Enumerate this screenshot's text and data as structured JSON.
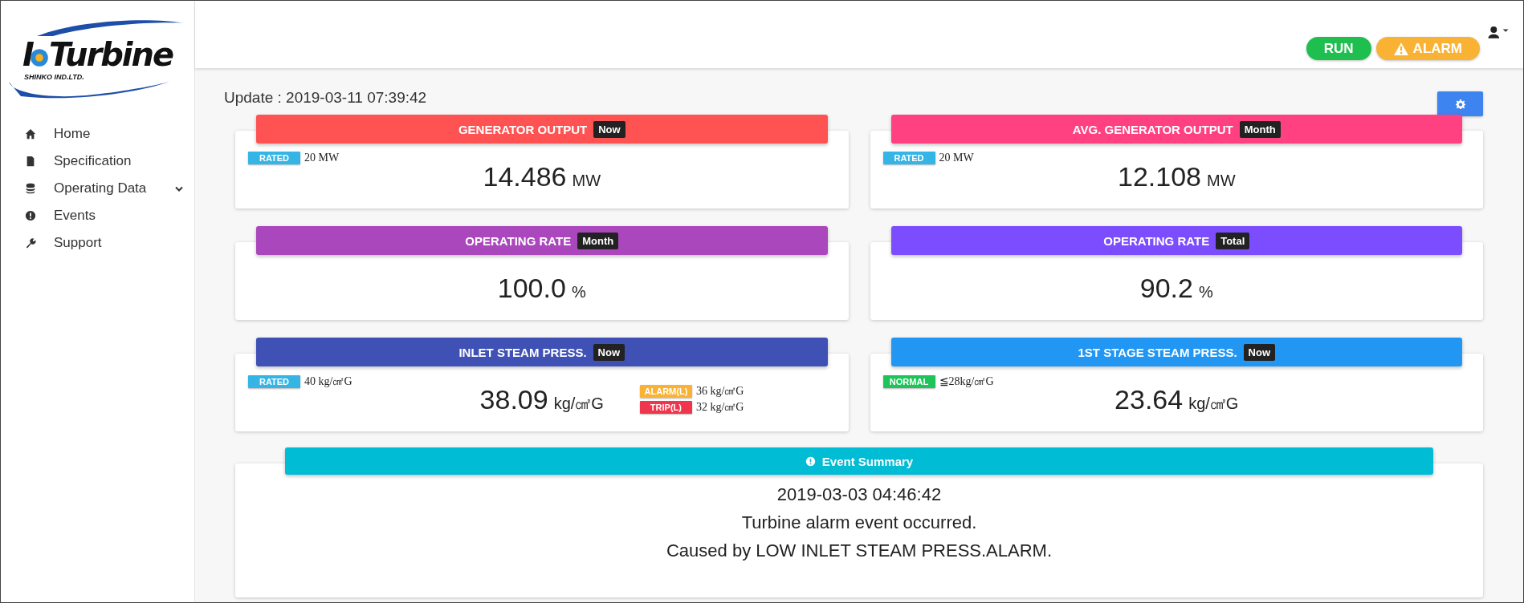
{
  "logo": {
    "prefix": "I",
    "name": "Turbine",
    "company": "SHINKO IND.LTD."
  },
  "sidebar": {
    "items": [
      {
        "label": "Home",
        "has_submenu": false
      },
      {
        "label": "Specification",
        "has_submenu": false
      },
      {
        "label": "Operating Data",
        "has_submenu": true
      },
      {
        "label": "Events",
        "has_submenu": false
      },
      {
        "label": "Support",
        "has_submenu": false
      }
    ]
  },
  "status": [
    {
      "label": "RUN",
      "kind": "plain",
      "color": "#1fbf4f"
    },
    {
      "label": "ALARM",
      "kind": "warning",
      "color": "#f9b233"
    }
  ],
  "update": "Update : 2019-03-11 07:39:42",
  "cards": [
    {
      "title": "GENERATOR OUTPUT",
      "badge": "Now",
      "color": "#ff5252",
      "tag": {
        "label": "RATED",
        "value": "20 MW",
        "color": "#35b5e5"
      },
      "value": "14.486",
      "unit": "MW"
    },
    {
      "title": "AVG. GENERATOR OUTPUT",
      "badge": "Month",
      "color": "#ff4081",
      "tag": {
        "label": "RATED",
        "value": "20 MW",
        "color": "#35b5e5"
      },
      "value": "12.108",
      "unit": "MW"
    },
    {
      "title": "OPERATING RATE",
      "badge": "Month",
      "color": "#ab47bc",
      "value": "100.0",
      "unit": "%"
    },
    {
      "title": "OPERATING RATE",
      "badge": "Total",
      "color": "#7c4dff",
      "value": "90.2",
      "unit": "%"
    },
    {
      "title": "INLET STEAM PRESS.",
      "badge": "Now",
      "color": "#3f51b5",
      "tag": {
        "label": "RATED",
        "value": "40 kg/㎠G",
        "color": "#35b5e5"
      },
      "value": "38.09",
      "unit": "kg/㎠G",
      "limits": [
        {
          "label": "ALARM(L)",
          "value": "36 kg/㎠G",
          "color": "#f9b233"
        },
        {
          "label": "TRIP(L)",
          "value": "32 kg/㎠G",
          "color": "#f0364d"
        }
      ]
    },
    {
      "title": "1ST STAGE STEAM PRESS.",
      "badge": "Now",
      "color": "#2196f3",
      "tag": {
        "label": "NORMAL",
        "value": "≦28kg/㎠G",
        "color": "#1ec45a"
      },
      "value": "23.64",
      "unit": "kg/㎠G"
    }
  ],
  "event_summary": {
    "title": "Event Summary",
    "lines": [
      "2019-03-03 04:46:42",
      "Turbine alarm event occurred.",
      "Caused by LOW INLET STEAM PRESS.ALARM."
    ]
  }
}
